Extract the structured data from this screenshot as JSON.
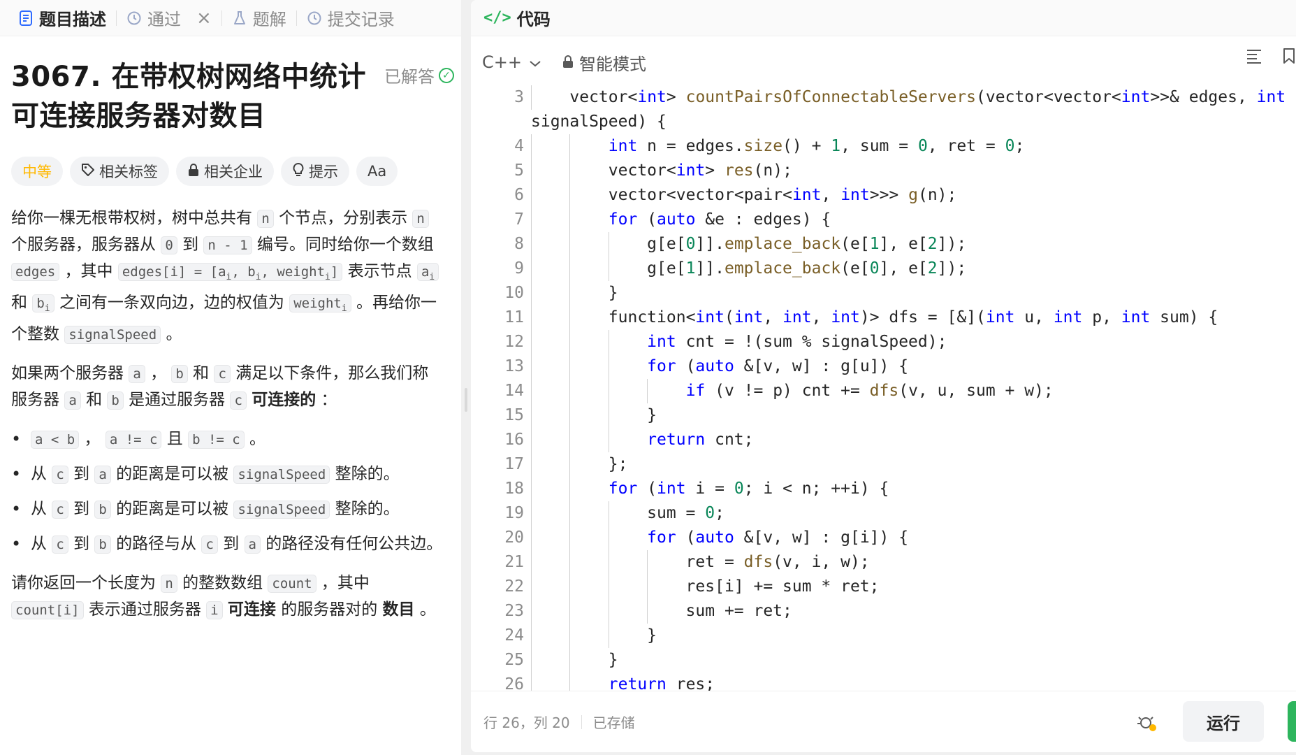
{
  "left_tabs": [
    {
      "label": "题目描述",
      "icon": "doc-icon",
      "active": true
    },
    {
      "label": "通过",
      "icon": "history-icon",
      "active": false
    },
    {
      "label": "题解",
      "icon": "flask-icon",
      "active": false
    },
    {
      "label": "提交记录",
      "icon": "history-icon",
      "active": false
    }
  ],
  "problem": {
    "title": "3067. 在带权树网络中统计可连接服务器对数目",
    "status": "已解答",
    "difficulty": "中等",
    "badges": [
      "相关标签",
      "相关企业",
      "提示",
      "Aa"
    ],
    "p1": {
      "t1": "给你一棵无根带权树，树中总共有 ",
      "c1": "n",
      "t2": " 个节点，分别表示 ",
      "c2": "n",
      "t3": " 个服务器，服务器从 ",
      "c3": "0",
      "t4": " 到 ",
      "c4": "n - 1",
      "t5": " 编号。同时给你一个数组 ",
      "c5": "edges",
      "t6": " ，其中 ",
      "c6": "edges[i] = [a",
      "c6s1": "i",
      "c6b": ", b",
      "c6s2": "i",
      "c6c": ", weight",
      "c6s3": "i",
      "c6d": "]",
      "t7": " 表示节点 ",
      "c7": "a",
      "c7s": "i",
      "t8": " 和 ",
      "c8": "b",
      "c8s": "i",
      "t9": " 之间有一条双向边，边的权值为 ",
      "c9": "weight",
      "c9s": "i",
      "t10": " 。再给你一个整数 ",
      "c10": "signalSpeed",
      "t11": " 。"
    },
    "p2": {
      "t1": "如果两个服务器 ",
      "c1": "a",
      "t2": " ， ",
      "c2": "b",
      "t3": " 和 ",
      "c3": "c",
      "t4": " 满足以下条件，那么我们称服务器 ",
      "c4": "a",
      "t5": " 和 ",
      "c5": "b",
      "t6": " 是通过服务器 ",
      "c6": "c",
      "t7": " ",
      "bold": "可连接的",
      "t8": " ："
    },
    "bullets": {
      "b1": {
        "c1": "a < b",
        "t1": " ， ",
        "c2": "a != c",
        "t2": " 且 ",
        "c3": "b != c",
        "t3": " 。"
      },
      "b2": {
        "t0": "从 ",
        "c1": "c",
        "t1": " 到 ",
        "c2": "a",
        "t2": " 的距离是可以被 ",
        "c3": "signalSpeed",
        "t3": " 整除的。"
      },
      "b3": {
        "t0": "从 ",
        "c1": "c",
        "t1": " 到 ",
        "c2": "b",
        "t2": " 的距离是可以被 ",
        "c3": "signalSpeed",
        "t3": " 整除的。"
      },
      "b4": {
        "t0": "从 ",
        "c1": "c",
        "t1": " 到 ",
        "c2": "b",
        "t2": " 的路径与从 ",
        "c3": "c",
        "t3": " 到 ",
        "c4": "a",
        "t4": " 的路径没有任何公共边。"
      }
    },
    "p3": {
      "t1": "请你返回一个长度为 ",
      "c1": "n",
      "t2": " 的整数数组 ",
      "c2": "count",
      "t3": " ，其中 ",
      "c3": "count[i]",
      "t4": " 表示通过服务器 ",
      "c4": "i",
      "t5": " ",
      "bold1": "可连接",
      "t6": " 的服务器对的 ",
      "bold2": "数目",
      "t7": " 。"
    }
  },
  "code_panel": {
    "title": "代码",
    "language": "C++",
    "mode": "智能模式"
  },
  "status_bar": {
    "position": "行 26，列 20",
    "saved": "已存储",
    "run_label": "运行"
  },
  "code_lines": [
    {
      "n": "3",
      "text": "    vector<int> countPairsOfConnectableServers(vector<vector<int>>& edges, int"
    },
    {
      "n": "",
      "text": "signalSpeed) {"
    },
    {
      "n": "4",
      "text": "        int n = edges.size() + 1, sum = 0, ret = 0;"
    },
    {
      "n": "5",
      "text": "        vector<int> res(n);"
    },
    {
      "n": "6",
      "text": "        vector<vector<pair<int, int>>> g(n);"
    },
    {
      "n": "7",
      "text": "        for (auto &e : edges) {"
    },
    {
      "n": "8",
      "text": "            g[e[0]].emplace_back(e[1], e[2]);"
    },
    {
      "n": "9",
      "text": "            g[e[1]].emplace_back(e[0], e[2]);"
    },
    {
      "n": "10",
      "text": "        }"
    },
    {
      "n": "11",
      "text": "        function<int(int, int, int)> dfs = [&](int u, int p, int sum) {"
    },
    {
      "n": "12",
      "text": "            int cnt = !(sum % signalSpeed);"
    },
    {
      "n": "13",
      "text": "            for (auto &[v, w] : g[u]) {"
    },
    {
      "n": "14",
      "text": "                if (v != p) cnt += dfs(v, u, sum + w);"
    },
    {
      "n": "15",
      "text": "            }"
    },
    {
      "n": "16",
      "text": "            return cnt;"
    },
    {
      "n": "17",
      "text": "        };"
    },
    {
      "n": "18",
      "text": "        for (int i = 0; i < n; ++i) {"
    },
    {
      "n": "19",
      "text": "            sum = 0;"
    },
    {
      "n": "20",
      "text": "            for (auto &[v, w] : g[i]) {"
    },
    {
      "n": "21",
      "text": "                ret = dfs(v, i, w);"
    },
    {
      "n": "22",
      "text": "                res[i] += sum * ret;"
    },
    {
      "n": "23",
      "text": "                sum += ret;"
    },
    {
      "n": "24",
      "text": "            }"
    },
    {
      "n": "25",
      "text": "        }"
    },
    {
      "n": "26",
      "text": "        return res;"
    }
  ],
  "colors": {
    "accent_green": "#2db55d",
    "difficulty_medium": "#ffb800",
    "keyword": "#0000ff",
    "function": "#795e26",
    "number": "#098658"
  }
}
